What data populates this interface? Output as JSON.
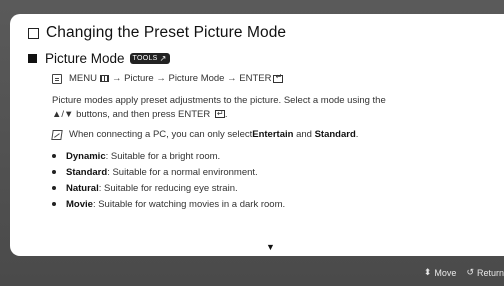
{
  "page": {
    "title": "Changing the Preset Picture Mode"
  },
  "section": {
    "title": "Picture Mode",
    "tools_badge": "TOOLS",
    "tools_glyph": "↗"
  },
  "path": {
    "menu": "MENU",
    "arrow1": "→",
    "picture": "Picture",
    "arrow2": "→",
    "picture_mode": "Picture Mode",
    "arrow3": "→",
    "enter": "ENTER"
  },
  "description": {
    "line1": "Picture modes apply preset adjustments to the picture. Select a mode using the",
    "line2_start": "▲/▼ buttons, and then press ",
    "line2_enter": "ENTER",
    "line2_end": "."
  },
  "note": {
    "text_before": "When connecting a PC, you can only select ",
    "entertain": "Entertain",
    "text_and": " and ",
    "standard": "Standard",
    "text_end": "."
  },
  "modes": [
    {
      "name": "Dynamic",
      "desc": ": Suitable for a bright room."
    },
    {
      "name": "Standard",
      "desc": ": Suitable for a normal environment."
    },
    {
      "name": "Natural",
      "desc": ": Suitable for reducing eye strain."
    },
    {
      "name": "Movie",
      "desc": ": Suitable for watching movies in a dark room."
    }
  ],
  "scroll_indicator": "▼",
  "footer": {
    "move_icon": "updown-arrow-icon",
    "move_label": "Move",
    "return_icon": "return-arrow-icon",
    "return_label": "Return"
  }
}
